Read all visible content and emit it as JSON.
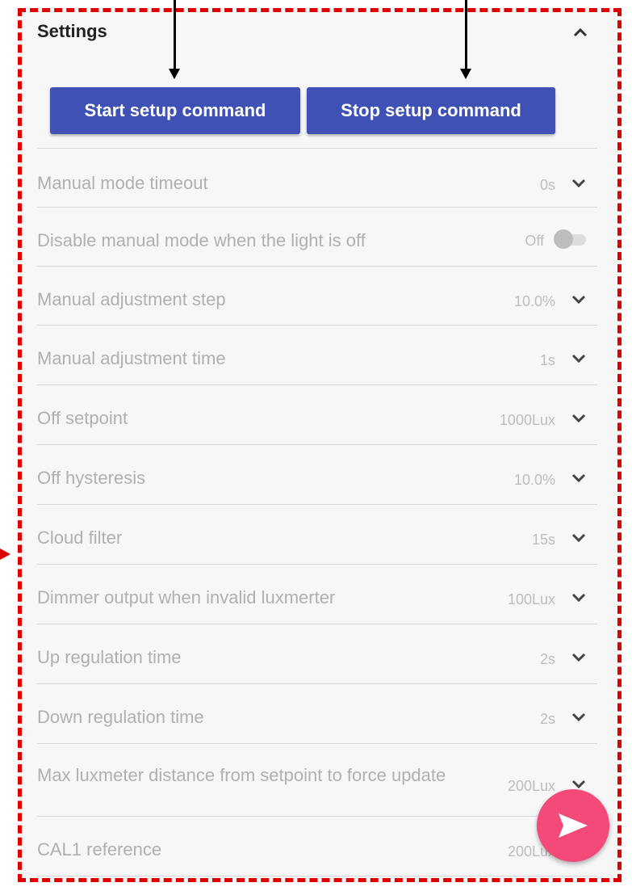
{
  "settings": {
    "title": "Settings",
    "start_button": "Start setup command",
    "stop_button": "Stop setup command",
    "rows": [
      {
        "label": "Manual mode timeout",
        "value": "0s"
      },
      {
        "label": "Disable manual mode when the light is off",
        "value": "Off"
      },
      {
        "label": "Manual adjustment step",
        "value": "10.0%"
      },
      {
        "label": "Manual adjustment time",
        "value": "1s"
      },
      {
        "label": "Off setpoint",
        "value": "1000Lux"
      },
      {
        "label": "Off hysteresis",
        "value": "10.0%"
      },
      {
        "label": "Cloud filter",
        "value": "15s"
      },
      {
        "label": "Dimmer output when invalid luxmerter",
        "value": "100Lux"
      },
      {
        "label": "Up regulation time",
        "value": "2s"
      },
      {
        "label": "Down regulation time",
        "value": "2s"
      },
      {
        "label": "Max luxmeter distance from setpoint to force update",
        "value": "200Lux"
      },
      {
        "label": "CAL1 reference",
        "value": "200Lux"
      }
    ],
    "toggle_state": "off"
  },
  "colors": {
    "primary": "#3f51b5",
    "fab": "#f44a7a",
    "annotation": "#e00000"
  }
}
